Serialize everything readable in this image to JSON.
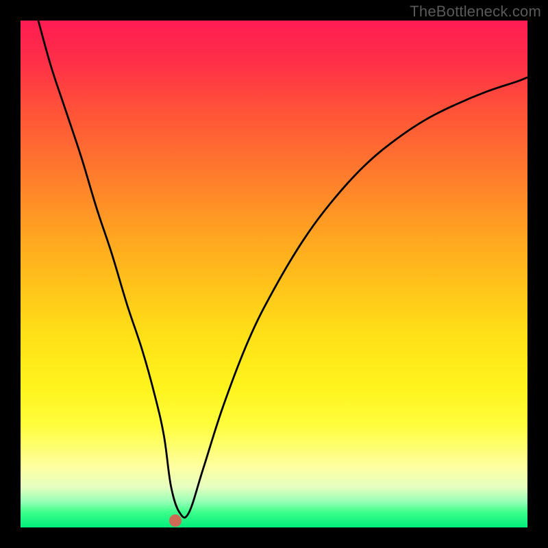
{
  "watermark": "TheBottleneck.com",
  "chart_data": {
    "type": "line",
    "title": "",
    "xlabel": "",
    "ylabel": "",
    "xlim": [
      0,
      100
    ],
    "ylim": [
      0,
      100
    ],
    "grid": false,
    "legend_position": "none",
    "marker": {
      "x": 30.5,
      "y": 1.3,
      "color": "#cf6a55"
    },
    "series": [
      {
        "name": "curve",
        "x": [
          3.5,
          6,
          9,
          12,
          15,
          18,
          21,
          24,
          26.5,
          28.3,
          29.7,
          31.4,
          33.2,
          36,
          40,
          45,
          50,
          56,
          62,
          68,
          74,
          80,
          86,
          92,
          98,
          100
        ],
        "values": [
          100,
          91,
          82,
          73,
          63,
          54,
          44,
          35,
          26,
          18,
          8,
          2.9,
          2.9,
          11.5,
          24,
          37,
          47,
          57,
          65,
          71.5,
          76.5,
          80.5,
          83.5,
          86,
          88,
          88.8
        ]
      }
    ],
    "background_gradient_stops": [
      {
        "pos": 0.0,
        "color": "#ff1c52"
      },
      {
        "pos": 0.08,
        "color": "#ff2f48"
      },
      {
        "pos": 0.18,
        "color": "#ff5338"
      },
      {
        "pos": 0.3,
        "color": "#ff7a2d"
      },
      {
        "pos": 0.42,
        "color": "#ffa321"
      },
      {
        "pos": 0.52,
        "color": "#ffc21a"
      },
      {
        "pos": 0.62,
        "color": "#ffe018"
      },
      {
        "pos": 0.72,
        "color": "#fff31c"
      },
      {
        "pos": 0.8,
        "color": "#fffd3d"
      },
      {
        "pos": 0.88,
        "color": "#fdffa0"
      },
      {
        "pos": 0.92,
        "color": "#e6ffc0"
      },
      {
        "pos": 0.95,
        "color": "#94ffb4"
      },
      {
        "pos": 0.97,
        "color": "#3cff8a"
      },
      {
        "pos": 1.0,
        "color": "#00ee7a"
      }
    ]
  }
}
